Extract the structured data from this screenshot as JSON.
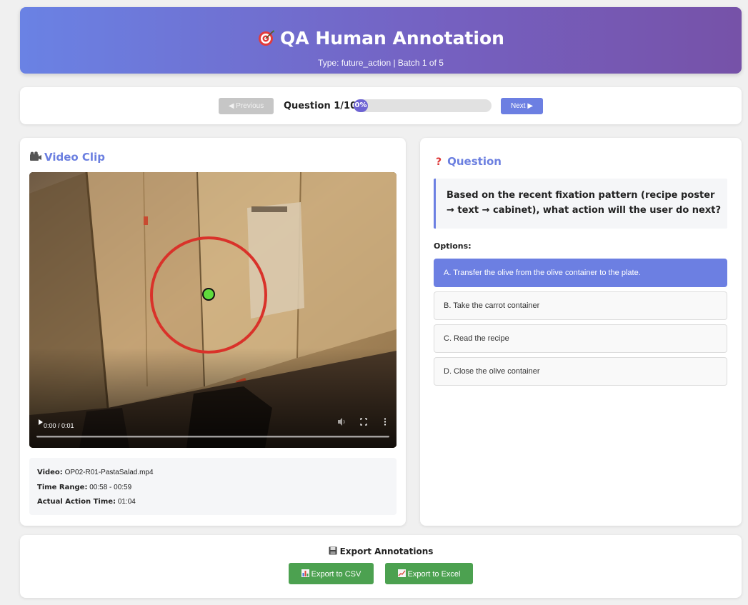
{
  "header": {
    "title": "QA Human Annotation",
    "subtitle": "Type: future_action | Batch 1 of 5"
  },
  "nav": {
    "prev_label": "◀ Previous",
    "question_counter": "Question 1/10",
    "progress_label": "0%",
    "progress_fraction": 0.1,
    "next_label": "Next ▶"
  },
  "video": {
    "section_title": "Video Clip",
    "time_display": "0:00 / 0:01",
    "info": {
      "video_label": "Video:",
      "video_value": "OP02-R01-PastaSalad.mp4",
      "range_label": "Time Range:",
      "range_value": "00:58 - 00:59",
      "action_label": "Actual Action Time:",
      "action_value": "01:04"
    }
  },
  "question": {
    "section_title": "Question",
    "mark": "?",
    "text": "Based on the recent fixation pattern (recipe poster → text → cabinet), what action will the user do next?",
    "options_label": "Options:",
    "options": [
      "A. Transfer the olive from the olive container to the plate.",
      "B. Take the carrot container",
      "C. Read the recipe",
      "D. Close the olive container"
    ],
    "selected_index": 0
  },
  "export": {
    "title": "Export Annotations",
    "csv_label": "Export to CSV",
    "excel_label": "Export to Excel"
  },
  "colors": {
    "accent": "#6c7fe2",
    "export_green": "#4ca150",
    "gaze_ring": "#d9322a",
    "gaze_point": "#5fdc3c"
  }
}
